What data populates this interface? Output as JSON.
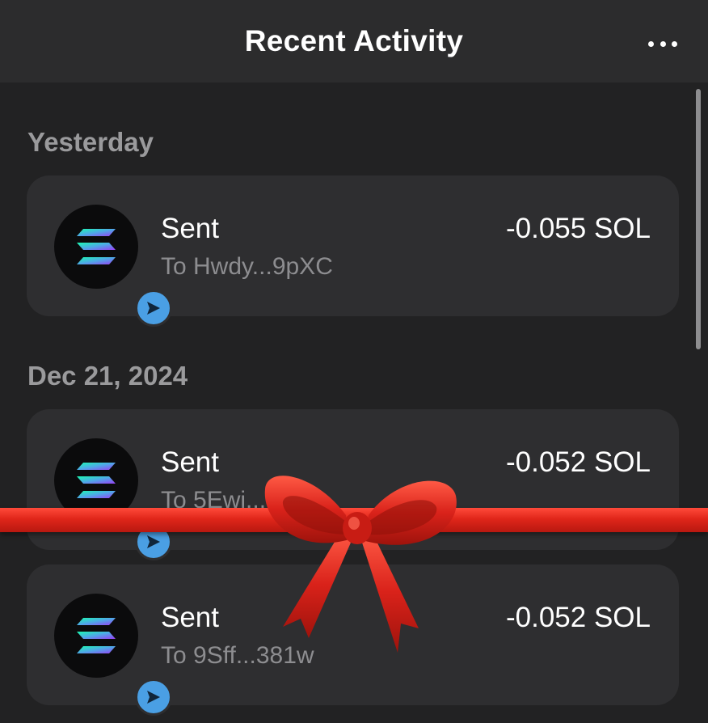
{
  "header": {
    "title": "Recent Activity",
    "menu_icon": "more-horizontal-icon"
  },
  "sections": [
    {
      "label": "Yesterday",
      "transactions": [
        {
          "type": "Sent",
          "subtitle": "To Hwdy...9pXC",
          "amount": "-0.055 SOL",
          "token_icon": "solana-logo-icon",
          "badge_icon": "send-arrow-icon"
        }
      ]
    },
    {
      "label": "Dec 21, 2024",
      "transactions": [
        {
          "type": "Sent",
          "subtitle": "To 5Ewi...F",
          "amount": "-0.052 SOL",
          "token_icon": "solana-logo-icon",
          "badge_icon": "send-arrow-icon"
        },
        {
          "type": "Sent",
          "subtitle": "To 9Sff...381w",
          "amount": "-0.052 SOL",
          "token_icon": "solana-logo-icon",
          "badge_icon": "send-arrow-icon"
        }
      ]
    }
  ],
  "colors": {
    "background": "#222223",
    "header": "#2c2c2d",
    "card": "#2e2e30",
    "badge": "#4a9fe4",
    "ribbon": "#e0261a"
  }
}
